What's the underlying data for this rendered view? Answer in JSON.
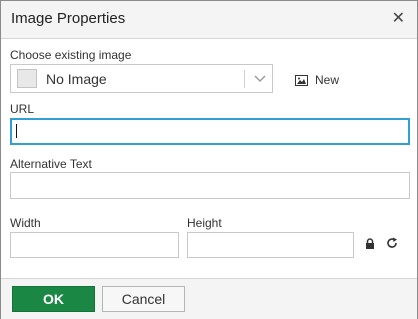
{
  "dialog": {
    "title": "Image Properties",
    "close_icon": "close-icon"
  },
  "existing_image": {
    "label": "Choose existing image",
    "selected": "No Image",
    "new_label": "New"
  },
  "url": {
    "label": "URL",
    "value": ""
  },
  "alt_text": {
    "label": "Alternative Text",
    "value": ""
  },
  "width": {
    "label": "Width",
    "value": ""
  },
  "height": {
    "label": "Height",
    "value": ""
  },
  "buttons": {
    "ok": "OK",
    "cancel": "Cancel"
  },
  "colors": {
    "ok_bg": "#1a8745",
    "focus_border": "#2f9fd6"
  }
}
